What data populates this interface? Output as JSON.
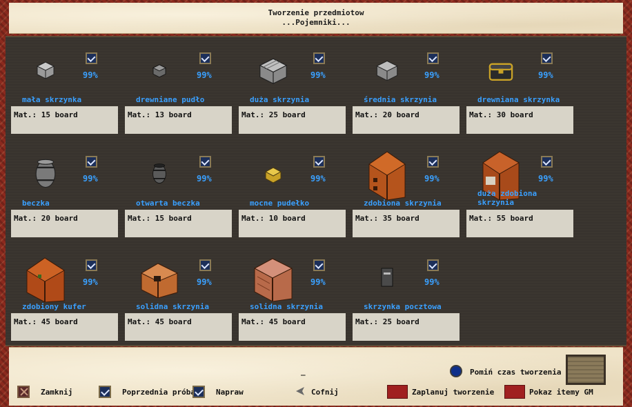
{
  "header": {
    "title": "Tworzenie przedmiotow",
    "category": "...Pojemniki..."
  },
  "items": [
    {
      "name": "mała skrzynka",
      "mat": "Mat.: 15 board",
      "pct": "99%",
      "icon": "small-crate-icon"
    },
    {
      "name": "drewniane pudło",
      "mat": "Mat.: 13 board",
      "pct": "99%",
      "icon": "wooden-box-icon"
    },
    {
      "name": "duża skrzynia",
      "mat": "Mat.: 25 board",
      "pct": "99%",
      "icon": "large-crate-icon"
    },
    {
      "name": "średnia skrzynia",
      "mat": "Mat.: 20 board",
      "pct": "99%",
      "icon": "medium-crate-icon"
    },
    {
      "name": "drewniana skrzynka",
      "mat": "Mat.: 30 board",
      "pct": "99%",
      "icon": "wooden-chest-icon"
    },
    {
      "name": "beczka",
      "mat": "Mat.: 20 board",
      "pct": "99%",
      "icon": "barrel-icon"
    },
    {
      "name": "otwarta beczka",
      "mat": "Mat.: 15 board",
      "pct": "99%",
      "icon": "open-barrel-icon"
    },
    {
      "name": "mocne pudełko",
      "mat": "Mat.: 10 board",
      "pct": "99%",
      "icon": "strong-box-icon"
    },
    {
      "name": "zdobiona skrzynia",
      "mat": "Mat.: 35 board",
      "pct": "99%",
      "icon": "ornate-chest-icon"
    },
    {
      "name": "duża zdobiona skrzynia",
      "mat": "Mat.: 55 board",
      "pct": "99%",
      "icon": "large-ornate-chest-icon"
    },
    {
      "name": "zdobiony kufer",
      "mat": "Mat.: 45 board",
      "pct": "99%",
      "icon": "ornate-trunk-icon"
    },
    {
      "name": "solidna skrzynia",
      "mat": "Mat.: 45 board",
      "pct": "99%",
      "icon": "solid-chest-icon"
    },
    {
      "name": "solidna skrzynia",
      "mat": "Mat.: 45 board",
      "pct": "99%",
      "icon": "solid-chest-2-icon"
    },
    {
      "name": "skrzynka pocztowa",
      "mat": "Mat.: 25 board",
      "pct": "99%",
      "icon": "mailbox-icon"
    }
  ],
  "footer": {
    "skip_label": "Pomiń czas tworzenia",
    "status_text": "_",
    "close_label": "Zamknij",
    "previous_label": "Poprzednia próba",
    "repair_label": "Napraw",
    "back_label": "Cofnij",
    "schedule_label": "Zaplanuj tworzenie",
    "show_gm_label": "Pokaz itemy GM"
  },
  "colors": {
    "accent_text": "#3aa0ff",
    "mat_box": "#d8d4c8",
    "grid_bg": "#3b3630"
  }
}
